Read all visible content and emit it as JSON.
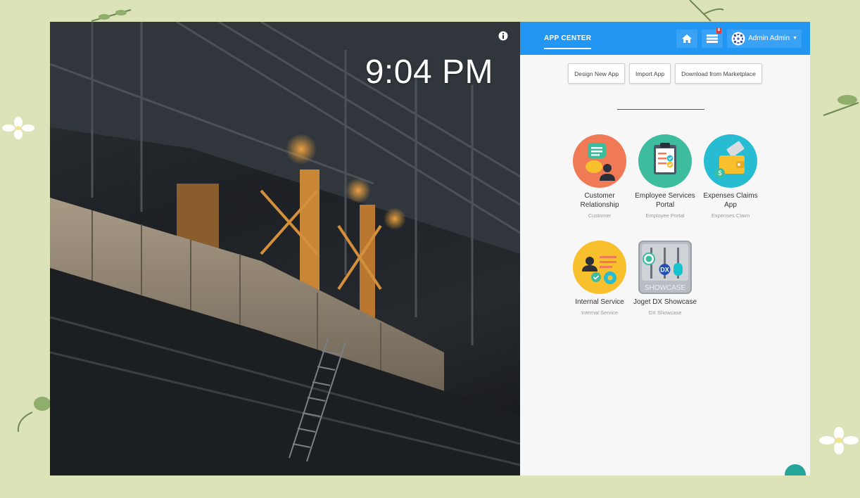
{
  "clock": {
    "time": "9:04 PM"
  },
  "header": {
    "brand": "APP CENTER",
    "notification_count": "8",
    "user_name": "Admin Admin"
  },
  "actions": {
    "design": "Design New App",
    "import": "Import App",
    "marketplace": "Download from Marketplace"
  },
  "search": {
    "placeholder": ""
  },
  "apps": [
    {
      "name": "Customer Relationship",
      "sub": "Customer",
      "color": "#f07a55"
    },
    {
      "name": "Employee Services Portal",
      "sub": "Employee Portal",
      "color": "#3dbd9d"
    },
    {
      "name": "Expenses Claims App",
      "sub": "Expenses Claim",
      "color": "#27bcd1"
    },
    {
      "name": "Internal Service",
      "sub": "Internal Service",
      "color": "#f8c02c"
    },
    {
      "name": "Joget DX Showcase",
      "sub": "DX Showcase",
      "logo_text": "SHOWCASE",
      "badge": "DX"
    }
  ],
  "colors": {
    "topbar": "#2196f3",
    "background": "#dde3b9",
    "panel": "#f7f7f7"
  }
}
